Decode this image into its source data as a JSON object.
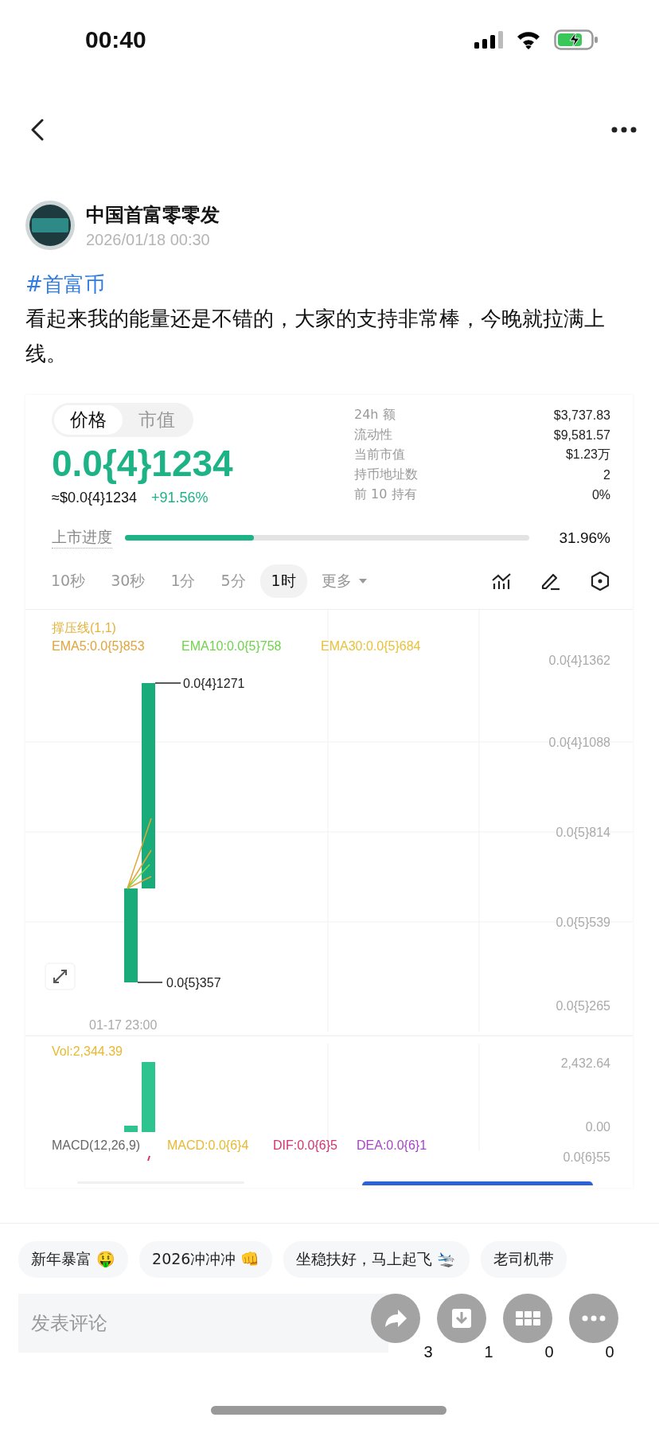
{
  "status_bar": {
    "time": "00:40"
  },
  "post": {
    "author": "中国首富零零发",
    "time": "2026/01/18 00:30",
    "hashtag": "#首富币",
    "text": "看起来我的能量还是不错的，大家的支持非常棒，今晚就拉满上线。"
  },
  "card": {
    "tabs": [
      {
        "label": "价格",
        "selected": true
      },
      {
        "label": "市值",
        "selected": false
      }
    ],
    "price": "0.0{4}1234",
    "usd": "≈$0.0{4}1234",
    "change": "+91.56%",
    "stats": [
      {
        "label": "24h  额",
        "value": "$3,737.83"
      },
      {
        "label": "流动性",
        "value": "$9,581.57"
      },
      {
        "label": "当前市值",
        "value": "$1.23万"
      },
      {
        "label": "持币地址数",
        "value": "2"
      },
      {
        "label": "前 10 持有",
        "value": "0%"
      }
    ],
    "progress": {
      "label": "上市进度",
      "level": 0.3196,
      "reading": "31.96%"
    },
    "intervals": [
      {
        "label": "10秒",
        "selected": false
      },
      {
        "label": "30秒",
        "selected": false
      },
      {
        "label": "1分",
        "selected": false
      },
      {
        "label": "5分",
        "selected": false
      },
      {
        "label": "1时",
        "selected": true
      }
    ],
    "more": "更多"
  },
  "chart": {
    "indicator": "撑压线(1,1)",
    "ema": [
      {
        "text": "EMA5:0.0{5}853",
        "color": "#e3a33b"
      },
      {
        "text": "EMA10:0.0{5}758",
        "color": "#6fd44a"
      },
      {
        "text": "EMA30:0.0{5}684",
        "color": "#e8c23a"
      }
    ],
    "y_labels": [
      "0.0{4}1362",
      "0.0{4}1088",
      "0.0{5}814",
      "0.0{5}539",
      "0.0{5}265"
    ],
    "high_label": "0.0{4}1271",
    "low_label": "0.0{5}357",
    "time_label": "01-17 23:00",
    "vol": "Vol:2,344.39",
    "vol_ticks": [
      "2,432.64",
      "0.00"
    ],
    "macd": [
      {
        "text": "MACD(12,26,9)",
        "color": "#666666"
      },
      {
        "text": "MACD:0.0{6}4",
        "color": "#e8b931"
      },
      {
        "text": "DIF:0.0{6}5",
        "color": "#d4336f"
      },
      {
        "text": "DEA:0.0{6}1",
        "color": "#a844c8"
      }
    ],
    "macd_tick": "0.0{6}55"
  },
  "chips": [
    "新年暴富 🤑",
    "2026冲冲冲 👊",
    "坐稳扶好，马上起飞 🛬",
    "老司机带"
  ],
  "comment": {
    "placeholder": "发表评论"
  },
  "counts": [
    "3",
    "1",
    "0",
    "0"
  ]
}
